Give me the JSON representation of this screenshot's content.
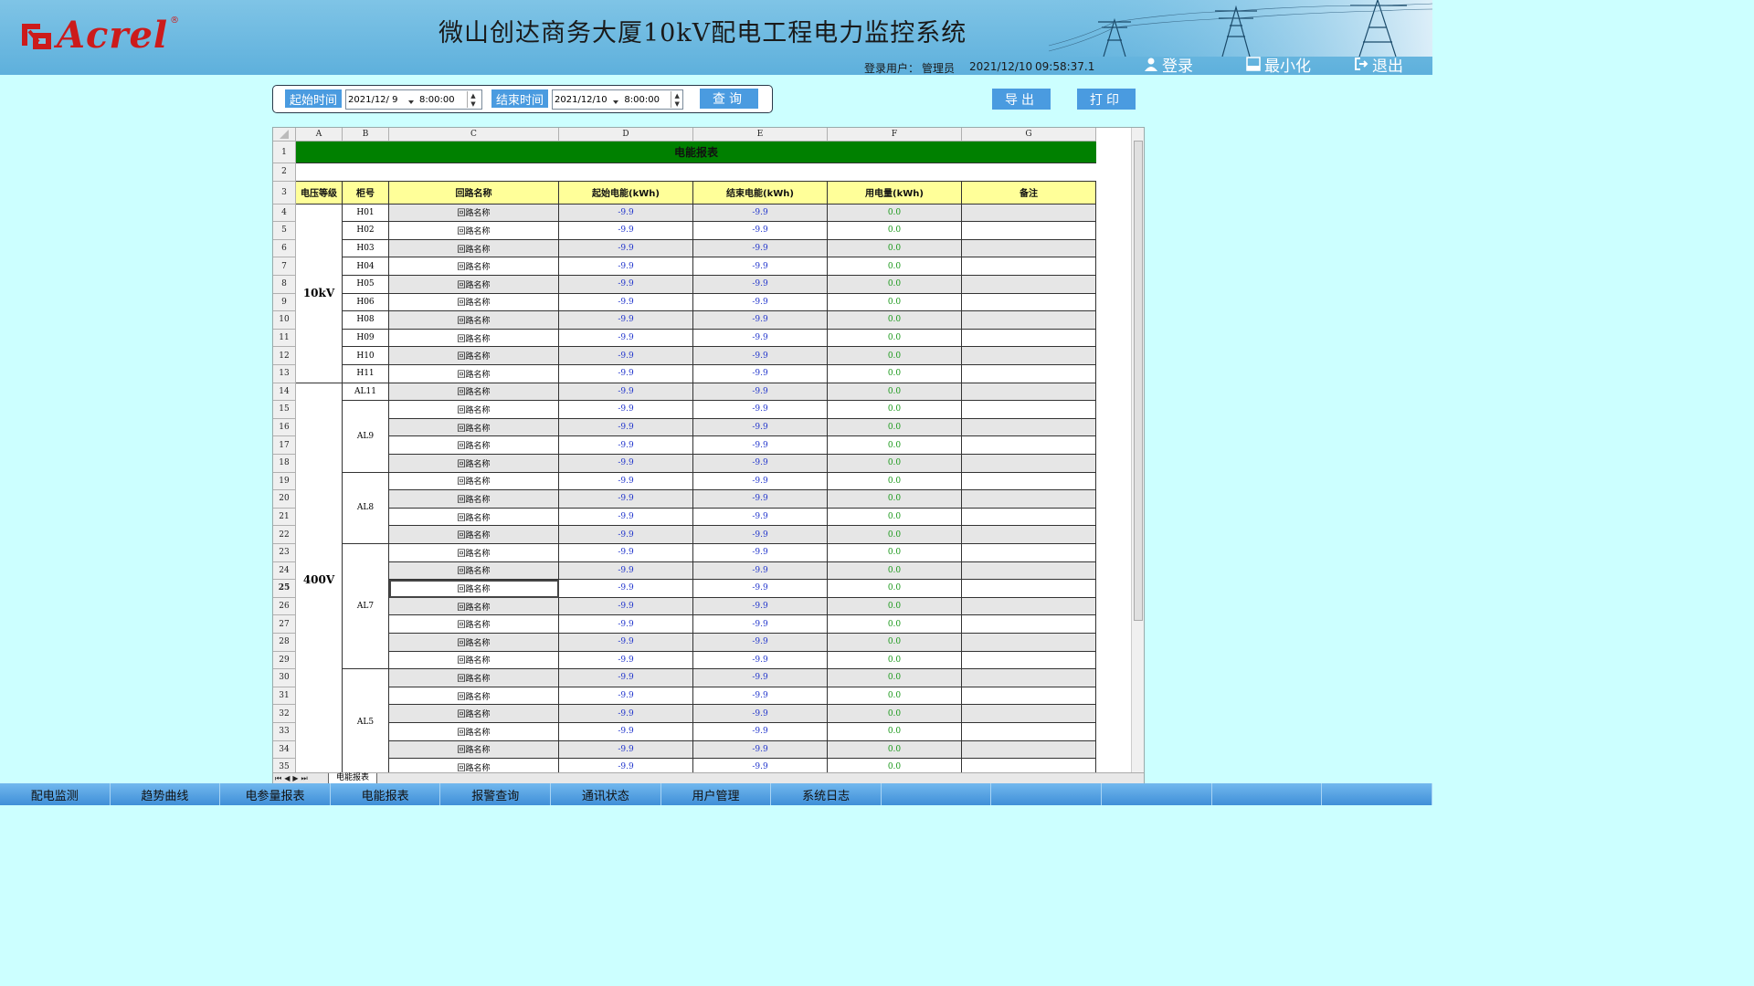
{
  "header": {
    "brand": "Acrel",
    "brand_mark": "®",
    "title": "微山创达商务大厦10kV配电工程电力监控系统",
    "user_label": "登录用户：",
    "user": "管理员",
    "date": "2021/12/10",
    "time": "09:58:37.1",
    "login": "登录",
    "minimize": "最小化",
    "logout": "退出"
  },
  "toolbar": {
    "start_label": "起始时间",
    "start_date": "2021/12/ 9",
    "start_time": "8:00:00",
    "end_label": "结束时间",
    "end_date": "2021/12/10",
    "end_time": "8:00:00",
    "query": "查询",
    "export": "导出",
    "print": "打印"
  },
  "sheet": {
    "columns": [
      "A",
      "B",
      "C",
      "D",
      "E",
      "F",
      "G"
    ],
    "report_title": "电能报表",
    "headers": [
      "电压等级",
      "柜号",
      "回路名称",
      "起始电能(kWh)",
      "结束电能(kWh)",
      "用电量(kWh)",
      "备注"
    ],
    "voltage_groups": [
      {
        "label": "10kV",
        "from": 4,
        "to": 13
      },
      {
        "label": "400V",
        "from": 14,
        "to": 35
      }
    ],
    "cabinets": [
      {
        "label": "H01",
        "from": 4,
        "to": 4
      },
      {
        "label": "H02",
        "from": 5,
        "to": 5
      },
      {
        "label": "H03",
        "from": 6,
        "to": 6
      },
      {
        "label": "H04",
        "from": 7,
        "to": 7
      },
      {
        "label": "H05",
        "from": 8,
        "to": 8
      },
      {
        "label": "H06",
        "from": 9,
        "to": 9
      },
      {
        "label": "H08",
        "from": 10,
        "to": 10
      },
      {
        "label": "H09",
        "from": 11,
        "to": 11
      },
      {
        "label": "H10",
        "from": 12,
        "to": 12
      },
      {
        "label": "H11",
        "from": 13,
        "to": 13
      },
      {
        "label": "AL11",
        "from": 14,
        "to": 14
      },
      {
        "label": "AL9",
        "from": 15,
        "to": 18
      },
      {
        "label": "AL8",
        "from": 19,
        "to": 22
      },
      {
        "label": "AL7",
        "from": 23,
        "to": 29
      },
      {
        "label": "AL5",
        "from": 30,
        "to": 35
      }
    ],
    "circuit_name": "回路名称",
    "start_value": "-9.9",
    "end_value": "-9.9",
    "usage_value": "0.0",
    "first_data_row": 4,
    "last_data_row": 35,
    "selected_row": 25,
    "tab_name": "电能报表",
    "tab_nav": "⏮◀▶⏭"
  },
  "nav": [
    "配电监测",
    "趋势曲线",
    "电参量报表",
    "电能报表",
    "报警查询",
    "通讯状态",
    "用户管理",
    "系统日志",
    "",
    "",
    "",
    "",
    ""
  ]
}
